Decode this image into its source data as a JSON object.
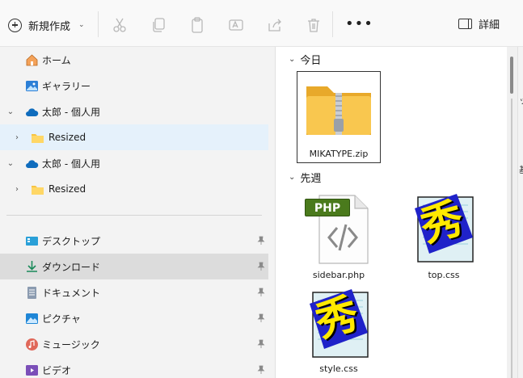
{
  "toolbar": {
    "new_label": "新規作成",
    "icons": [
      "cut-icon",
      "copy-icon",
      "paste-icon",
      "rename-icon",
      "share-icon",
      "delete-icon",
      "sort-icon"
    ],
    "more_label": "•••",
    "details_label": "詳細"
  },
  "nav": {
    "items": [
      {
        "label": "ホーム",
        "icon": "home-icon"
      },
      {
        "label": "ギャラリー",
        "icon": "gallery-icon"
      },
      {
        "label": "太郎 - 個人用",
        "icon": "onedrive-icon"
      },
      {
        "label": "Resized",
        "icon": "folder-icon"
      },
      {
        "label": "太郎 - 個人用",
        "icon": "onedrive-icon"
      },
      {
        "label": "Resized",
        "icon": "folder-icon"
      },
      {
        "label": "デスクトップ",
        "icon": "desktop-icon"
      },
      {
        "label": "ダウンロード",
        "icon": "download-icon"
      },
      {
        "label": "ドキュメント",
        "icon": "document-icon"
      },
      {
        "label": "ピクチャ",
        "icon": "pictures-icon"
      },
      {
        "label": "ミュージック",
        "icon": "music-icon"
      },
      {
        "label": "ビデオ",
        "icon": "video-icon"
      }
    ]
  },
  "content": {
    "groups": [
      {
        "label": "今日",
        "files": [
          {
            "name": "MIKATYPE.zip",
            "icon": "zip-folder-icon"
          }
        ]
      },
      {
        "label": "先週",
        "files": [
          {
            "name": "sidebar.php",
            "icon": "php-file-icon",
            "badge": "PHP"
          },
          {
            "name": "top.css",
            "icon": "hidemaru-icon",
            "glyph": "秀"
          },
          {
            "name": "style.css",
            "icon": "hidemaru-icon",
            "glyph": "秀"
          }
        ]
      }
    ]
  },
  "edge": {
    "t1": "ッ",
    "t2": "基"
  },
  "colors": {
    "accent": "#0067c0",
    "selected_bg": "#e5f1fb",
    "folder": "#f7c443"
  }
}
